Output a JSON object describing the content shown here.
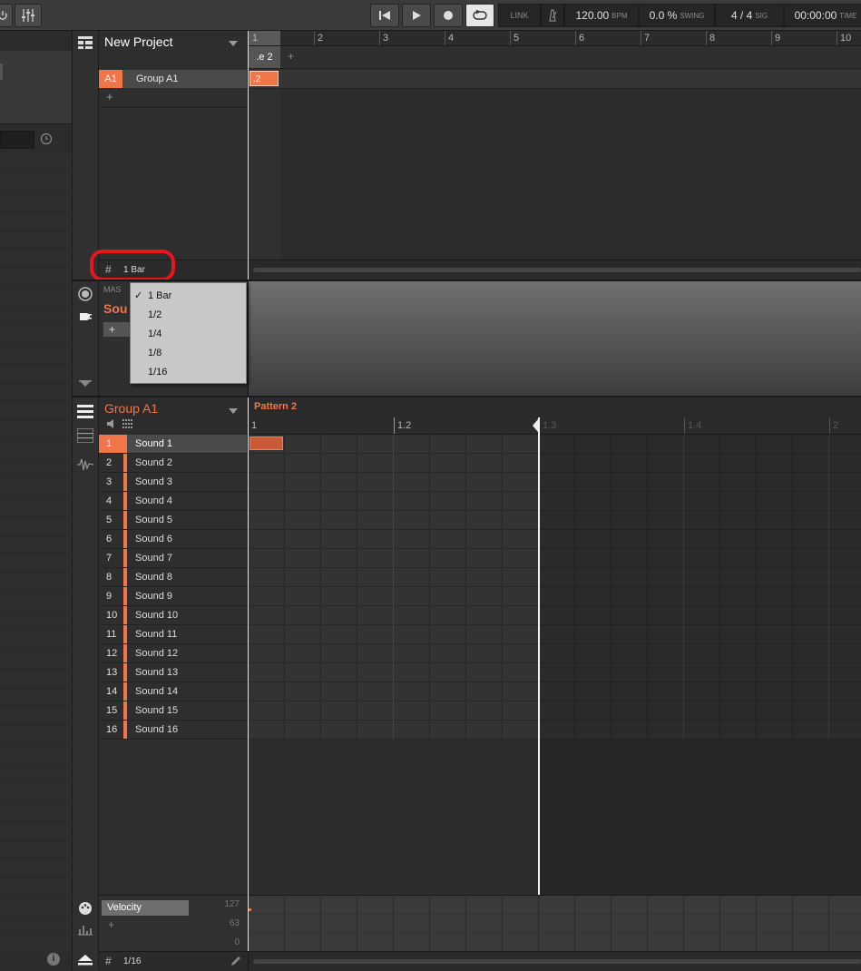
{
  "transport": {
    "link": "LINK",
    "tempo": "120.00",
    "tempo_unit": "BPM",
    "swing": "0.0 %",
    "swing_label": "SWING",
    "signature": "4 / 4",
    "signature_label": "SIG",
    "time": "00:00:00",
    "time_label": "TIME"
  },
  "arranger": {
    "project_title": "New Project",
    "group_code": "A1",
    "group_name": "Group A1",
    "add_symbol": "+",
    "section_tab": ".e 2",
    "section_add": "+",
    "clip_label": ".2",
    "bar_numbers": [
      "1",
      "2",
      "3",
      "4",
      "5",
      "6",
      "7",
      "8",
      "9",
      "10"
    ],
    "grid_value": "1 Bar"
  },
  "mixer_strip": {
    "master_label": "MAS",
    "sound_label": "Sou",
    "add_symbol": "+"
  },
  "grid_dropdown": {
    "items": [
      "1 Bar",
      "1/2",
      "1/4",
      "1/8",
      "1/16"
    ],
    "selected": "1 Bar",
    "check": "✓"
  },
  "pattern_editor": {
    "group_title": "Group A1",
    "pattern_name": "Pattern 2",
    "ruler_labels": [
      "1",
      "1.2",
      "1.3",
      "1.4",
      "2"
    ],
    "sounds": [
      {
        "num": "1",
        "name": "Sound 1"
      },
      {
        "num": "2",
        "name": "Sound 2"
      },
      {
        "num": "3",
        "name": "Sound 3"
      },
      {
        "num": "4",
        "name": "Sound 4"
      },
      {
        "num": "5",
        "name": "Sound 5"
      },
      {
        "num": "6",
        "name": "Sound 6"
      },
      {
        "num": "7",
        "name": "Sound 7"
      },
      {
        "num": "8",
        "name": "Sound 8"
      },
      {
        "num": "9",
        "name": "Sound 9"
      },
      {
        "num": "10",
        "name": "Sound 10"
      },
      {
        "num": "11",
        "name": "Sound 11"
      },
      {
        "num": "12",
        "name": "Sound 12"
      },
      {
        "num": "13",
        "name": "Sound 13"
      },
      {
        "num": "14",
        "name": "Sound 14"
      },
      {
        "num": "15",
        "name": "Sound 15"
      },
      {
        "num": "16",
        "name": "Sound 16"
      }
    ],
    "velocity_label": "Velocity",
    "velocity_max": "127",
    "velocity_mid": "63",
    "velocity_min": "0",
    "add_symbol": "+",
    "step_grid": "1/16"
  },
  "info_symbol": "i",
  "colors": {
    "accent": "#f0764a",
    "annotation": "#e8141e"
  }
}
